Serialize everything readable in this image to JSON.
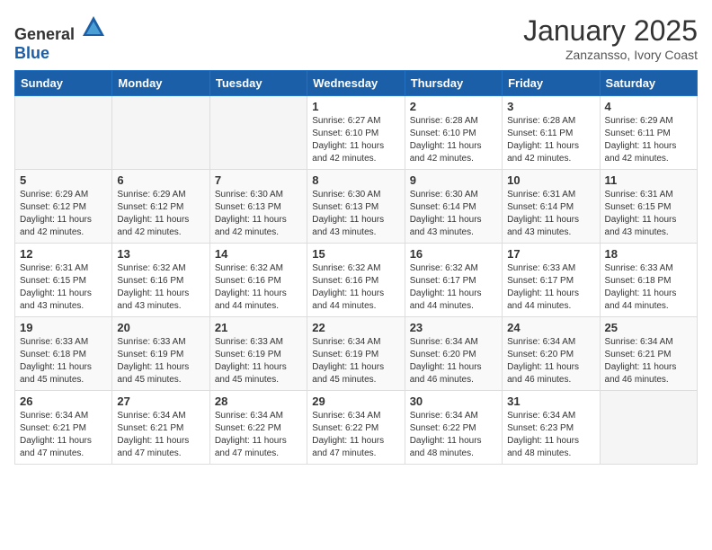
{
  "header": {
    "logo_general": "General",
    "logo_blue": "Blue",
    "month": "January 2025",
    "location": "Zanzansso, Ivory Coast"
  },
  "weekdays": [
    "Sunday",
    "Monday",
    "Tuesday",
    "Wednesday",
    "Thursday",
    "Friday",
    "Saturday"
  ],
  "weeks": [
    [
      {
        "day": "",
        "info": ""
      },
      {
        "day": "",
        "info": ""
      },
      {
        "day": "",
        "info": ""
      },
      {
        "day": "1",
        "info": "Sunrise: 6:27 AM\nSunset: 6:10 PM\nDaylight: 11 hours\nand 42 minutes."
      },
      {
        "day": "2",
        "info": "Sunrise: 6:28 AM\nSunset: 6:10 PM\nDaylight: 11 hours\nand 42 minutes."
      },
      {
        "day": "3",
        "info": "Sunrise: 6:28 AM\nSunset: 6:11 PM\nDaylight: 11 hours\nand 42 minutes."
      },
      {
        "day": "4",
        "info": "Sunrise: 6:29 AM\nSunset: 6:11 PM\nDaylight: 11 hours\nand 42 minutes."
      }
    ],
    [
      {
        "day": "5",
        "info": "Sunrise: 6:29 AM\nSunset: 6:12 PM\nDaylight: 11 hours\nand 42 minutes."
      },
      {
        "day": "6",
        "info": "Sunrise: 6:29 AM\nSunset: 6:12 PM\nDaylight: 11 hours\nand 42 minutes."
      },
      {
        "day": "7",
        "info": "Sunrise: 6:30 AM\nSunset: 6:13 PM\nDaylight: 11 hours\nand 42 minutes."
      },
      {
        "day": "8",
        "info": "Sunrise: 6:30 AM\nSunset: 6:13 PM\nDaylight: 11 hours\nand 43 minutes."
      },
      {
        "day": "9",
        "info": "Sunrise: 6:30 AM\nSunset: 6:14 PM\nDaylight: 11 hours\nand 43 minutes."
      },
      {
        "day": "10",
        "info": "Sunrise: 6:31 AM\nSunset: 6:14 PM\nDaylight: 11 hours\nand 43 minutes."
      },
      {
        "day": "11",
        "info": "Sunrise: 6:31 AM\nSunset: 6:15 PM\nDaylight: 11 hours\nand 43 minutes."
      }
    ],
    [
      {
        "day": "12",
        "info": "Sunrise: 6:31 AM\nSunset: 6:15 PM\nDaylight: 11 hours\nand 43 minutes."
      },
      {
        "day": "13",
        "info": "Sunrise: 6:32 AM\nSunset: 6:16 PM\nDaylight: 11 hours\nand 43 minutes."
      },
      {
        "day": "14",
        "info": "Sunrise: 6:32 AM\nSunset: 6:16 PM\nDaylight: 11 hours\nand 44 minutes."
      },
      {
        "day": "15",
        "info": "Sunrise: 6:32 AM\nSunset: 6:16 PM\nDaylight: 11 hours\nand 44 minutes."
      },
      {
        "day": "16",
        "info": "Sunrise: 6:32 AM\nSunset: 6:17 PM\nDaylight: 11 hours\nand 44 minutes."
      },
      {
        "day": "17",
        "info": "Sunrise: 6:33 AM\nSunset: 6:17 PM\nDaylight: 11 hours\nand 44 minutes."
      },
      {
        "day": "18",
        "info": "Sunrise: 6:33 AM\nSunset: 6:18 PM\nDaylight: 11 hours\nand 44 minutes."
      }
    ],
    [
      {
        "day": "19",
        "info": "Sunrise: 6:33 AM\nSunset: 6:18 PM\nDaylight: 11 hours\nand 45 minutes."
      },
      {
        "day": "20",
        "info": "Sunrise: 6:33 AM\nSunset: 6:19 PM\nDaylight: 11 hours\nand 45 minutes."
      },
      {
        "day": "21",
        "info": "Sunrise: 6:33 AM\nSunset: 6:19 PM\nDaylight: 11 hours\nand 45 minutes."
      },
      {
        "day": "22",
        "info": "Sunrise: 6:34 AM\nSunset: 6:19 PM\nDaylight: 11 hours\nand 45 minutes."
      },
      {
        "day": "23",
        "info": "Sunrise: 6:34 AM\nSunset: 6:20 PM\nDaylight: 11 hours\nand 46 minutes."
      },
      {
        "day": "24",
        "info": "Sunrise: 6:34 AM\nSunset: 6:20 PM\nDaylight: 11 hours\nand 46 minutes."
      },
      {
        "day": "25",
        "info": "Sunrise: 6:34 AM\nSunset: 6:21 PM\nDaylight: 11 hours\nand 46 minutes."
      }
    ],
    [
      {
        "day": "26",
        "info": "Sunrise: 6:34 AM\nSunset: 6:21 PM\nDaylight: 11 hours\nand 47 minutes."
      },
      {
        "day": "27",
        "info": "Sunrise: 6:34 AM\nSunset: 6:21 PM\nDaylight: 11 hours\nand 47 minutes."
      },
      {
        "day": "28",
        "info": "Sunrise: 6:34 AM\nSunset: 6:22 PM\nDaylight: 11 hours\nand 47 minutes."
      },
      {
        "day": "29",
        "info": "Sunrise: 6:34 AM\nSunset: 6:22 PM\nDaylight: 11 hours\nand 47 minutes."
      },
      {
        "day": "30",
        "info": "Sunrise: 6:34 AM\nSunset: 6:22 PM\nDaylight: 11 hours\nand 48 minutes."
      },
      {
        "day": "31",
        "info": "Sunrise: 6:34 AM\nSunset: 6:23 PM\nDaylight: 11 hours\nand 48 minutes."
      },
      {
        "day": "",
        "info": ""
      }
    ]
  ]
}
